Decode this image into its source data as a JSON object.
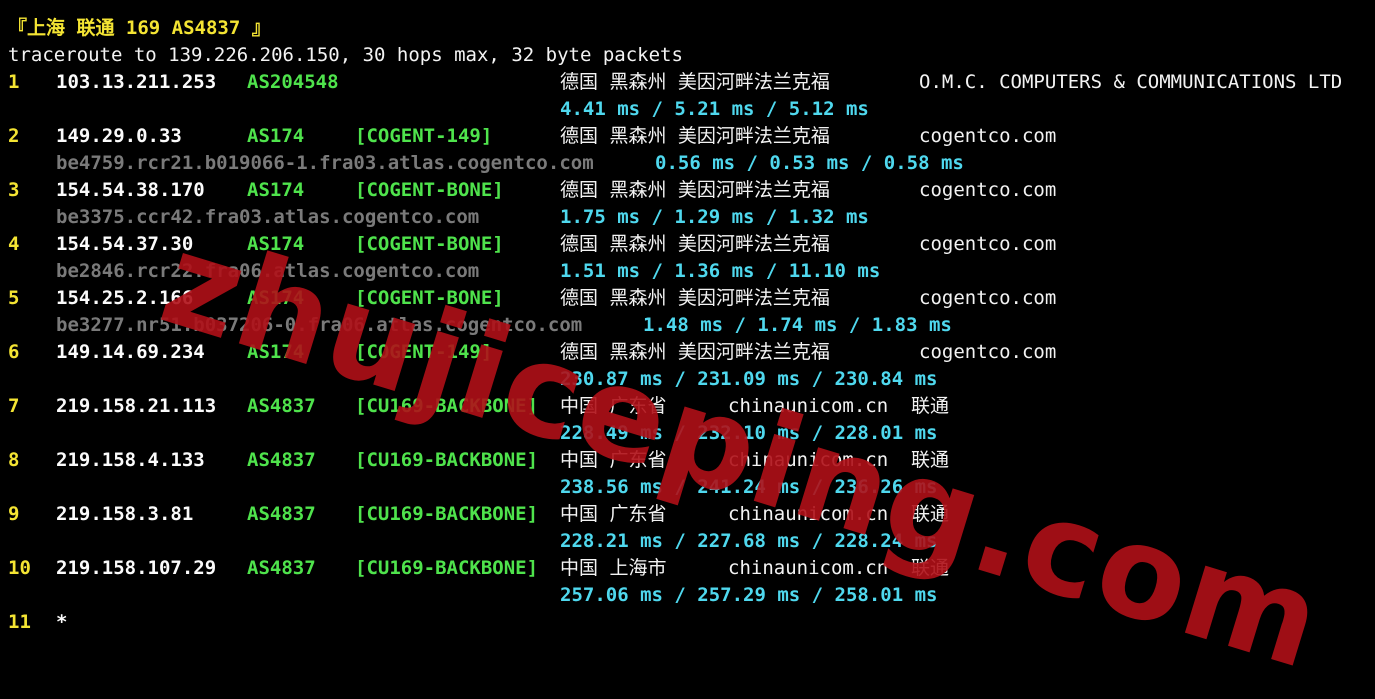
{
  "title": "『上海 联通 169 AS4837 』",
  "command": "traceroute to 139.226.206.150, 30 hops max, 32 byte packets",
  "hops": [
    {
      "num": "1",
      "ip": "103.13.211.253",
      "asn": "AS204548",
      "tag": "",
      "location": "德国 黑森州 美因河畔法兰克福",
      "org": "O.M.C. COMPUTERS & COMMUNICATIONS LTD",
      "rdns": "",
      "rtt": "4.41 ms / 5.21 ms / 5.12 ms"
    },
    {
      "num": "2",
      "ip": "149.29.0.33",
      "asn": "AS174",
      "tag": "[COGENT-149]",
      "location": "德国 黑森州 美因河畔法兰克福",
      "org": "cogentco.com",
      "rdns": "be4759.rcr21.b019066-1.fra03.atlas.cogentco.com",
      "rtt": "0.56 ms / 0.53 ms / 0.58 ms"
    },
    {
      "num": "3",
      "ip": "154.54.38.170",
      "asn": "AS174",
      "tag": "[COGENT-BONE]",
      "location": "德国 黑森州 美因河畔法兰克福",
      "org": "cogentco.com",
      "rdns": "be3375.ccr42.fra03.atlas.cogentco.com",
      "rtt": "1.75 ms / 1.29 ms / 1.32 ms"
    },
    {
      "num": "4",
      "ip": "154.54.37.30",
      "asn": "AS174",
      "tag": "[COGENT-BONE]",
      "location": "德国 黑森州 美因河畔法兰克福",
      "org": "cogentco.com",
      "rdns": "be2846.rcr22.fra06.atlas.cogentco.com",
      "rtt": "1.51 ms / 1.36 ms / 11.10 ms"
    },
    {
      "num": "5",
      "ip": "154.25.2.166",
      "asn": "AS174",
      "tag": "[COGENT-BONE]",
      "location": "德国 黑森州 美因河畔法兰克福",
      "org": "cogentco.com",
      "rdns": "be3277.nr51.b037206-0.fra06.atlas.cogentco.com",
      "rtt": "1.48 ms / 1.74 ms / 1.83 ms"
    },
    {
      "num": "6",
      "ip": "149.14.69.234",
      "asn": "AS174",
      "tag": "[COGENT-149]",
      "location": "德国 黑森州 美因河畔法兰克福",
      "org": "cogentco.com",
      "rdns": "",
      "rtt": "230.87 ms / 231.09 ms / 230.84 ms"
    },
    {
      "num": "7",
      "ip": "219.158.21.113",
      "asn": "AS4837",
      "tag": "[CU169-BACKBONE]",
      "location": "中国 广东省",
      "org": "chinaunicom.cn  联通",
      "rdns": "",
      "rtt": "228.49 ms / 232.10 ms / 228.01 ms"
    },
    {
      "num": "8",
      "ip": "219.158.4.133",
      "asn": "AS4837",
      "tag": "[CU169-BACKBONE]",
      "location": "中国 广东省",
      "org": "chinaunicom.cn  联通",
      "rdns": "",
      "rtt": "238.56 ms / 241.24 ms / 236.26 ms"
    },
    {
      "num": "9",
      "ip": "219.158.3.81",
      "asn": "AS4837",
      "tag": "[CU169-BACKBONE]",
      "location": "中国 广东省",
      "org": "chinaunicom.cn  联通",
      "rdns": "",
      "rtt": "228.21 ms / 227.68 ms / 228.24 ms"
    },
    {
      "num": "10",
      "ip": "219.158.107.29",
      "asn": "AS4837",
      "tag": "[CU169-BACKBONE]",
      "location": "中国 上海市",
      "org": "chinaunicom.cn  联通",
      "rdns": "",
      "rtt": "257.06 ms / 257.29 ms / 258.01 ms"
    },
    {
      "num": "11",
      "ip": "*",
      "asn": "",
      "tag": "",
      "location": "",
      "org": "",
      "rdns": "",
      "rtt": ""
    }
  ],
  "watermark": "zhujiceping.com",
  "colors": {
    "background": "#000000",
    "title": "#f4e433",
    "asn": "#4fe34c",
    "rtt": "#4fd8ee",
    "rdns": "#7a7a7a",
    "watermark": "#b01018"
  }
}
